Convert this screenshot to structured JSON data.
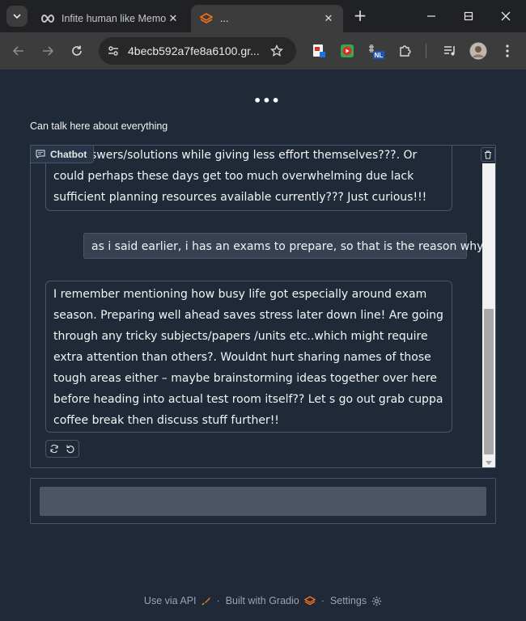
{
  "browser": {
    "tabs": [
      {
        "title": "Infite human like Memo",
        "icon": "infinity-icon",
        "active": false
      },
      {
        "title": "...",
        "icon": "gradio-icon",
        "active": true
      }
    ],
    "address": "4becb592a7fe8a6100.gr...",
    "extensions": [
      "pdf-extension-icon",
      "play-extension-icon",
      "nl-extension-icon",
      "puzzle-icon"
    ],
    "extension_badge": "NL"
  },
  "page": {
    "menu_dots": "•••",
    "heading": "Can talk here about everything"
  },
  "chatbot": {
    "label": "Chatbot",
    "messages": [
      {
        "role": "bot",
        "text": "swers/solutions while giving less effort themselves???. Or could perhaps these days get too much overwhelming due lack sufficient planning resources available currently??? Just curious!!!"
      },
      {
        "role": "user",
        "text": "as i said earlier, i has an exams to prepare, so that is the reason why"
      },
      {
        "role": "bot",
        "text": "I remember mentioning how busy life got especially around exam season. Preparing well ahead saves stress later down line! Are going through any tricky subjects/papers /units etc..which might require extra attention than others?. Wouldnt hurt sharing names of those tough areas either – maybe brainstorming ideas together over here before heading into actual test room itself?? Let s go out grab cuppa coffee break then discuss stuff further!!"
      }
    ]
  },
  "input": {
    "value": "",
    "placeholder": ""
  },
  "footer": {
    "api_label": "Use via API",
    "built_label": "Built with Gradio",
    "settings_label": "Settings",
    "separator": "·"
  },
  "colors": {
    "page_bg": "#1f2937",
    "border": "#475569",
    "user_bubble": "#374151",
    "input_bg": "#4b5563",
    "gradio_orange": "#f97316"
  }
}
